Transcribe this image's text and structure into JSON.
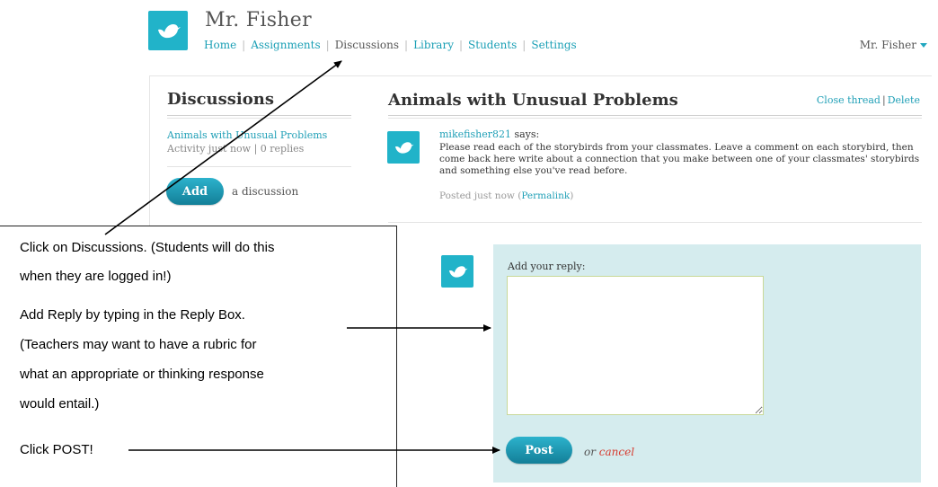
{
  "header": {
    "teacher_name": "Mr. Fisher",
    "user_menu_label": "Mr. Fisher"
  },
  "nav": {
    "items": [
      {
        "label": "Home"
      },
      {
        "label": "Assignments"
      },
      {
        "label": "Discussions"
      },
      {
        "label": "Library"
      },
      {
        "label": "Students"
      },
      {
        "label": "Settings"
      }
    ]
  },
  "sidebar": {
    "title": "Discussions",
    "thread_link": "Animals with Unusual Problems",
    "thread_meta": "Activity just now | 0 replies",
    "add_button_label": "Add",
    "add_suffix": "a discussion"
  },
  "thread": {
    "title": "Animals with Unusual Problems",
    "close_label": "Close thread",
    "separator": "|",
    "delete_label": "Delete",
    "author": "mikefisher821",
    "says": "says:",
    "body": "Please read each of the storybirds from your classmates. Leave a comment on each storybird, then come back here write about a connection that you make between one of your classmates' storybirds and something else you've read before.",
    "posted_text": "Posted just now",
    "permalink_label": "Permalink"
  },
  "reply": {
    "label": "Add your reply:",
    "textarea_value": "",
    "post_button_label": "Post",
    "or_text": "or",
    "cancel_label": "cancel"
  },
  "instructions": {
    "line1": "Click on Discussions. (Students will do this",
    "line2": "when they are logged in!)",
    "line3": "Add Reply by typing in the Reply Box.",
    "line4": "(Teachers may want to have a rubric for",
    "line5": "what an appropriate or thinking response",
    "line6": "would entail.)",
    "line7": "Click POST!"
  },
  "colors": {
    "brand_teal": "#21b3c9",
    "link_teal": "#21a0b7",
    "reply_panel_bg": "#d5ecee",
    "cancel_red": "#d63b2f"
  },
  "icons": {
    "logo": "bird-icon",
    "avatar": "bird-icon"
  }
}
